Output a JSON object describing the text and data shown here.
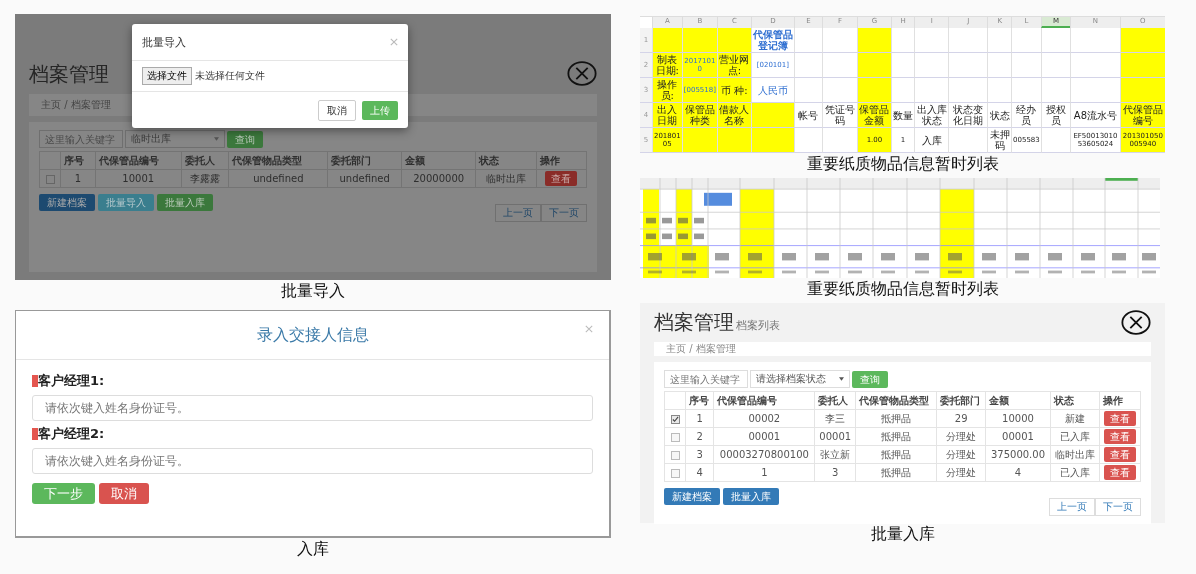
{
  "import_screen": {
    "page": {
      "title": "档案管理",
      "breadcrumb": "主页 / 档案管理",
      "search": {
        "placeholder": "这里输入关键字"
      },
      "status_select": {
        "value": "临时出库"
      },
      "query_button": "查询",
      "columns": [
        "序号",
        "代保管品编号",
        "委托人",
        "代保管物品类型",
        "委托部门",
        "金额",
        "状态",
        "操作"
      ],
      "rows": [
        {
          "checked": false,
          "cells": [
            "1",
            "10001",
            "李露露",
            "undefined",
            "undefined",
            "20000000",
            "临时出库"
          ],
          "action": "查看"
        }
      ],
      "buttons": [
        {
          "label": "新建档案",
          "kind": "primary"
        },
        {
          "label": "批量导入",
          "kind": "info"
        },
        {
          "label": "批量入库",
          "kind": "success"
        }
      ],
      "pager": [
        "上一页",
        "下一页"
      ]
    },
    "dialog": {
      "title": "批量导入",
      "file_button": "选择文件",
      "file_status": "未选择任何文件",
      "buttons": [
        {
          "label": "取消",
          "kind": "default"
        },
        {
          "label": "上传",
          "kind": "success"
        }
      ]
    },
    "caption": "批量导入"
  },
  "sheet": {
    "columns": [
      {
        "letter": "A",
        "selected": false
      },
      {
        "letter": "B",
        "selected": false
      },
      {
        "letter": "C",
        "selected": false
      },
      {
        "letter": "D",
        "selected": false
      },
      {
        "letter": "E",
        "selected": false
      },
      {
        "letter": "F",
        "selected": false
      },
      {
        "letter": "G",
        "selected": false
      },
      {
        "letter": "H",
        "selected": false
      },
      {
        "letter": "I",
        "selected": false
      },
      {
        "letter": "J",
        "selected": false
      },
      {
        "letter": "K",
        "selected": false
      },
      {
        "letter": "L",
        "selected": false
      },
      {
        "letter": "M",
        "selected": true
      },
      {
        "letter": "N",
        "selected": false
      },
      {
        "letter": "O",
        "selected": false
      }
    ],
    "rows": [
      {
        "number": "1",
        "cells": [
          {
            "text": "",
            "highlight": true
          },
          {
            "text": "",
            "highlight": true
          },
          {
            "text": "",
            "highlight": true
          },
          {
            "text": "代保管品登记簿",
            "highlight": false,
            "kind": "title"
          },
          {
            "text": "",
            "highlight": false
          },
          {
            "text": "",
            "highlight": false
          },
          {
            "text": "",
            "highlight": true
          },
          {
            "text": "",
            "highlight": false
          },
          {
            "text": "",
            "highlight": false
          },
          {
            "text": "",
            "highlight": false
          },
          {
            "text": "",
            "highlight": false
          },
          {
            "text": "",
            "highlight": false
          },
          {
            "text": "",
            "highlight": false
          },
          {
            "text": "",
            "highlight": false
          },
          {
            "text": "",
            "highlight": true
          }
        ]
      },
      {
        "number": "2",
        "cells": [
          {
            "text": "制表日期:",
            "highlight": true
          },
          {
            "text": "20171010",
            "highlight": true,
            "kind": "value"
          },
          {
            "text": "营业网点:",
            "highlight": true
          },
          {
            "text": "[020101]",
            "highlight": false,
            "kind": "value"
          },
          {
            "text": "",
            "highlight": false
          },
          {
            "text": "",
            "highlight": false
          },
          {
            "text": "",
            "highlight": true
          },
          {
            "text": "",
            "highlight": false
          },
          {
            "text": "",
            "highlight": false
          },
          {
            "text": "",
            "highlight": false
          },
          {
            "text": "",
            "highlight": false
          },
          {
            "text": "",
            "highlight": false
          },
          {
            "text": "",
            "highlight": false
          },
          {
            "text": "",
            "highlight": false
          },
          {
            "text": "",
            "highlight": true
          }
        ]
      },
      {
        "number": "3",
        "cells": [
          {
            "text": "操作员:",
            "highlight": true
          },
          {
            "text": "[005518]",
            "highlight": true,
            "kind": "value"
          },
          {
            "text": "币 种:",
            "highlight": true
          },
          {
            "text": "人民币",
            "highlight": false,
            "kind": "value"
          },
          {
            "text": "",
            "highlight": false
          },
          {
            "text": "",
            "highlight": false
          },
          {
            "text": "",
            "highlight": true
          },
          {
            "text": "",
            "highlight": false
          },
          {
            "text": "",
            "highlight": false
          },
          {
            "text": "",
            "highlight": false
          },
          {
            "text": "",
            "highlight": false
          },
          {
            "text": "",
            "highlight": false
          },
          {
            "text": "",
            "highlight": false
          },
          {
            "text": "",
            "highlight": false
          },
          {
            "text": "",
            "highlight": true
          }
        ]
      },
      {
        "number": "4",
        "cells": [
          {
            "text": "出入日期",
            "highlight": true
          },
          {
            "text": "保管品种类",
            "highlight": true
          },
          {
            "text": "借款人名称",
            "highlight": true
          },
          {
            "text": "",
            "highlight": true
          },
          {
            "text": "帐号",
            "highlight": false
          },
          {
            "text": "凭证号码",
            "highlight": false
          },
          {
            "text": "保管品金额",
            "highlight": true
          },
          {
            "text": "数量",
            "highlight": false
          },
          {
            "text": "出入库状态",
            "highlight": false
          },
          {
            "text": "状态变化日期",
            "highlight": false
          },
          {
            "text": "状态",
            "highlight": false
          },
          {
            "text": "经办员",
            "highlight": false
          },
          {
            "text": "授权员",
            "highlight": false
          },
          {
            "text": "A8流水号",
            "highlight": false
          },
          {
            "text": "代保管品编号",
            "highlight": true
          }
        ]
      },
      {
        "number": "5",
        "cells": [
          {
            "text": "20180105",
            "highlight": true
          },
          {
            "text": "",
            "highlight": true
          },
          {
            "text": "",
            "highlight": true
          },
          {
            "text": "",
            "highlight": true
          },
          {
            "text": "",
            "highlight": false
          },
          {
            "text": "",
            "highlight": false
          },
          {
            "text": "1.00",
            "highlight": true
          },
          {
            "text": "1",
            "highlight": false
          },
          {
            "text": "入库",
            "highlight": false
          },
          {
            "text": "",
            "highlight": false
          },
          {
            "text": "未押码",
            "highlight": false
          },
          {
            "text": "005583",
            "highlight": false
          },
          {
            "text": "",
            "highlight": false
          },
          {
            "text": "EF5001301053605024",
            "highlight": false
          },
          {
            "text": "201301050005940",
            "highlight": true
          }
        ]
      }
    ],
    "caption": "重要纸质物品信息暂时列表"
  },
  "sheet_picture": {
    "caption": "重要纸质物品信息暂时列表"
  },
  "handover_dialog": {
    "title": "录入交接人信息",
    "fields": [
      {
        "label": "客户经理1:",
        "required": true,
        "placeholder": "请依次键入姓名身份证号。"
      },
      {
        "label": "客户经理2:",
        "required": true,
        "placeholder": "请依次键入姓名身份证号。"
      }
    ],
    "buttons": [
      {
        "label": "下一步",
        "kind": "success"
      },
      {
        "label": "取消",
        "kind": "danger"
      }
    ],
    "caption": "入库"
  },
  "stock_screen": {
    "page": {
      "title": "档案管理",
      "subtitle": "档案列表",
      "breadcrumb": "主页 / 档案管理",
      "search": {
        "placeholder": "这里输入关键字"
      },
      "status_select": {
        "value": "请选择档案状态"
      },
      "query_button": "查询",
      "columns": [
        "序号",
        "代保管品编号",
        "委托人",
        "代保管物品类型",
        "委托部门",
        "金额",
        "状态",
        "操作"
      ],
      "rows": [
        {
          "checked": true,
          "cells": [
            "1",
            "00002",
            "李三",
            "抵押品",
            "29",
            "10000",
            "新建"
          ],
          "action": "查看"
        },
        {
          "checked": false,
          "cells": [
            "2",
            "00001",
            "00001",
            "抵押品",
            "分理处",
            "00001",
            "已入库"
          ],
          "action": "查看"
        },
        {
          "checked": false,
          "cells": [
            "3",
            "00003270800100",
            "张立新",
            "抵押品",
            "分理处",
            "375000.00",
            "临时出库"
          ],
          "action": "查看"
        },
        {
          "checked": false,
          "cells": [
            "4",
            "1",
            "3",
            "抵押品",
            "分理处",
            "4",
            "已入库"
          ],
          "action": "查看"
        }
      ],
      "buttons": [
        {
          "label": "新建档案",
          "kind": "primary"
        },
        {
          "label": "批量入库",
          "kind": "primary"
        }
      ],
      "pager": [
        "上一页",
        "下一页"
      ]
    },
    "caption": "批量入库"
  }
}
